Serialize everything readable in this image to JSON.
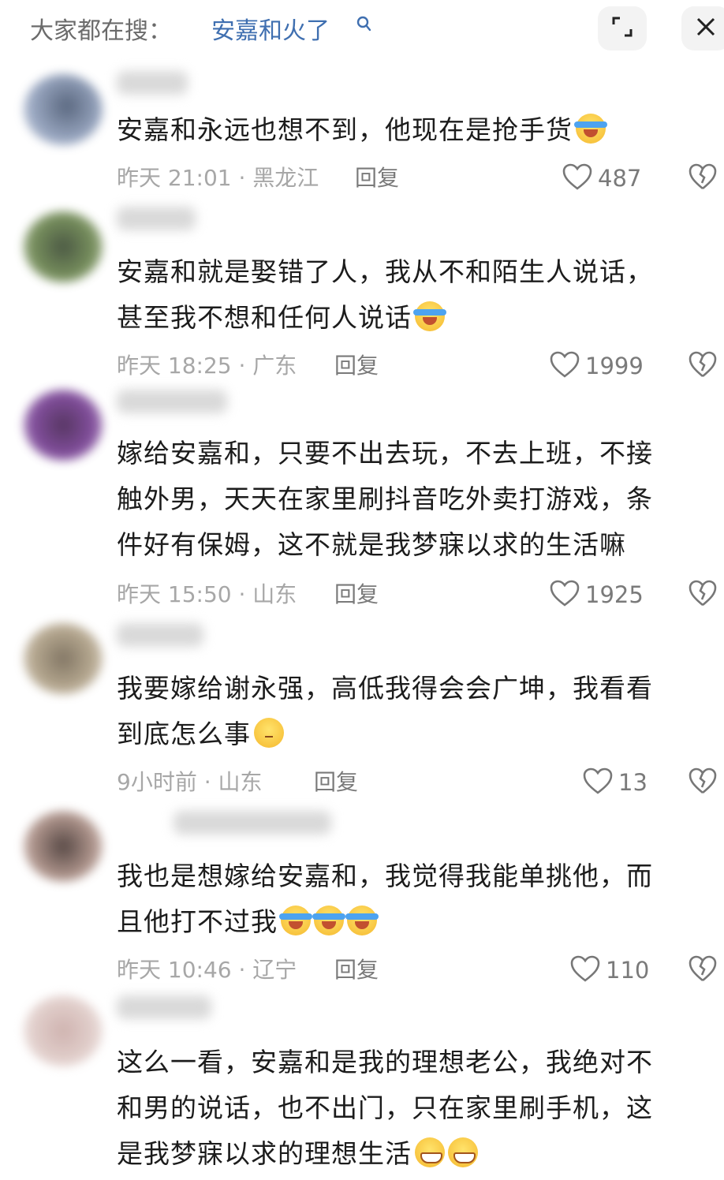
{
  "header": {
    "label": "大家都在搜：",
    "query": "安嘉和火了"
  },
  "comments": [
    {
      "text": "安嘉和永远也想不到，他现在是抢手货",
      "emoji": [
        "cry"
      ],
      "time": "昨天 21:01 · 黑龙江",
      "reply": "回复",
      "likes": "487"
    },
    {
      "text": "安嘉和就是娶错了人，我从不和陌生人说话，\n甚至我不想和任何人说话",
      "emoji": [
        "cry"
      ],
      "time": "昨天 18:25 · 广东",
      "reply": "回复",
      "likes": "1999"
    },
    {
      "text": "嫁给安嘉和，只要不出去玩，不去上班，不接\n触外男，天天在家里刷抖音吃外卖打游戏，条\n件好有保姆，这不就是我梦寐以求的生活嘛",
      "emoji": [],
      "time": "昨天 15:50 · 山东",
      "reply": "回复",
      "likes": "1925"
    },
    {
      "text": "我要嫁给谢永强，高低我得会会广坤，我看看\n到底怎么事",
      "emoji": [
        "think"
      ],
      "time": "9小时前 · 山东",
      "reply": "回复",
      "likes": "13"
    },
    {
      "text": "我也是想嫁给安嘉和，我觉得我能单挑他，而\n且他打不过我",
      "emoji": [
        "cry",
        "cry",
        "cry"
      ],
      "time": "昨天 10:46 · 辽宁",
      "reply": "回复",
      "likes": "110"
    },
    {
      "text": "这么一看，安嘉和是我的理想老公，我绝对不\n和男的说话，也不出门，只在家里刷手机，这\n是我梦寐以求的理想生活",
      "emoji": [
        "grin",
        "grin"
      ],
      "time": "",
      "reply": "",
      "likes": ""
    }
  ],
  "colors": {
    "query": "#3f6fb0",
    "meta": "#a7a7a7",
    "text": "#1c1c1c"
  }
}
